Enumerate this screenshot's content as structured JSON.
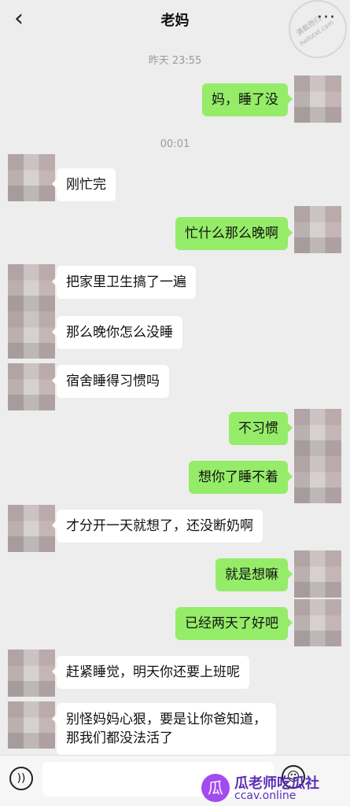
{
  "header": {
    "back_icon": "chevron-left-icon",
    "title": "老妈",
    "more_label": "···",
    "stamp_text": "满载而归",
    "stamp_url": "hellotxt.com"
  },
  "messages": [
    {
      "type": "time",
      "text": "昨天 23:55"
    },
    {
      "type": "out",
      "text": "妈，睡了没"
    },
    {
      "type": "time",
      "text": "00:01"
    },
    {
      "type": "in",
      "text": "刚忙完"
    },
    {
      "type": "out",
      "text": "忙什么那么晚啊"
    },
    {
      "type": "in",
      "text": "把家里卫生搞了一遍"
    },
    {
      "type": "in",
      "text": "那么晚你怎么没睡"
    },
    {
      "type": "in",
      "text": "宿舍睡得习惯吗"
    },
    {
      "type": "out",
      "text": "不习惯"
    },
    {
      "type": "out",
      "text": "想你了睡不着"
    },
    {
      "type": "in",
      "text": "才分开一天就想了，还没断奶啊"
    },
    {
      "type": "out",
      "text": "就是想嘛"
    },
    {
      "type": "out",
      "text": "已经两天了好吧"
    },
    {
      "type": "in",
      "text": "赶紧睡觉，明天你还要上班呢"
    },
    {
      "type": "in",
      "text": "别怪妈妈心狠，要是让你爸知道，\n那我们都没法活了"
    }
  ],
  "bottom": {
    "voice_icon": "voice-icon",
    "emoji_icon": "emoji-icon",
    "watermark_logo": "瓜",
    "watermark_name": "瓜老师吃瓜社",
    "watermark_url": "ccav.online"
  },
  "colors": {
    "background": "#ededed",
    "outgoing_bubble": "#95ec69",
    "incoming_bubble": "#ffffff"
  }
}
